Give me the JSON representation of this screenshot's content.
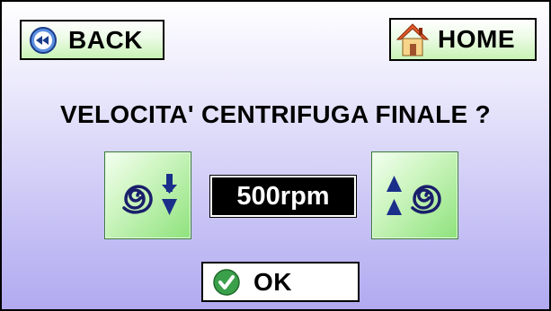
{
  "header": {
    "back_label": "BACK",
    "home_label": "HOME"
  },
  "title": "VELOCITA' CENTRIFUGA FINALE ?",
  "speed": {
    "value": "500rpm",
    "decrease_icon": "spiral-arrow-down-icon",
    "increase_icon": "spiral-arrow-up-icon"
  },
  "footer": {
    "ok_label": "OK"
  },
  "colors": {
    "button_green": "#8ee27c",
    "arrow_blue": "#1a2f8a",
    "spiral_blue": "#1a1f6b",
    "ok_check": "#3aa04a",
    "home_roof": "#e05a2a"
  }
}
